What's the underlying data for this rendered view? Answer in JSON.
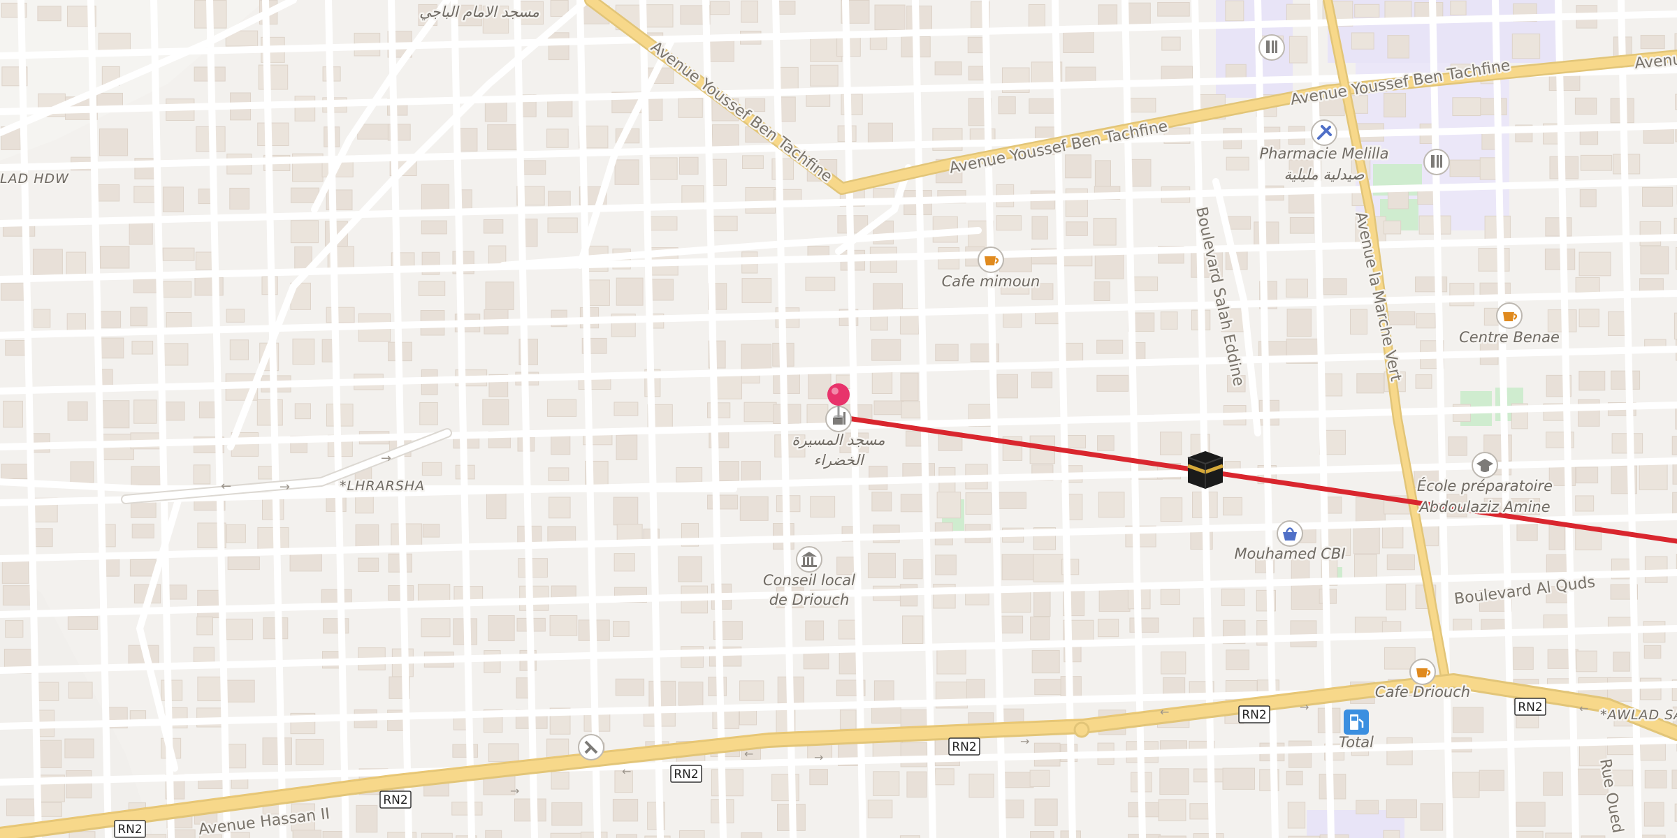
{
  "map": {
    "labels": {
      "mosque_imam_baji": "مسجد الامام الباجي",
      "avenue_youssef_1": "Avenue Youssef Ben Tachfine",
      "avenue_youssef_2": "Avenue Youssef Ben Tachfine",
      "avenue_youssef_3": "Avenue Youssef Ben Tachfine",
      "avenue_youssef_4": "Avenu",
      "lad_hdw": "LAD HDW",
      "pharmacie_fr": "Pharmacie Melilla",
      "pharmacie_ar": "صيدلية مليلية",
      "cafe_mimoun": "Cafe mimoun",
      "boulevard_salah": "Boulevard Salah Eddine",
      "avenue_marche": "Avenue la Marche Vert",
      "centre_benae": "Centre Benae",
      "lhrarsha": "*LHRARSHA",
      "mosque_massira_1": "مسجد المسيرة",
      "mosque_massira_2": "الخضراء",
      "ecole_1": "École préparatoire",
      "ecole_2": "Abdoulaziz Amine",
      "mouhamed_cbi": "Mouhamed CBI",
      "boulevard_quds": "Boulevard Al Quds",
      "conseil_1": "Conseil local",
      "conseil_2": "de Driouch",
      "cafe_driouch": "Cafe Driouch",
      "awlad": "*AWLAD SA",
      "total": "Total",
      "avenue_hassan": "Avenue Hassan II",
      "rue_oued": "Rue Oued"
    },
    "route_shields": [
      "RN2",
      "RN2",
      "RN2",
      "RN2",
      "RN2",
      "RN2"
    ],
    "colors": {
      "background": "#f3f1ee",
      "building": "#e8e0d8",
      "road_major": "#f7d88a",
      "route_line": "#d9262e",
      "marker": "#e8336b",
      "poi_icon": "#7d7b78",
      "cafe_icon": "#e08a1e",
      "shop_icon": "#4f6fc7",
      "fuel_icon": "#3b8fe0",
      "education_zone": "#e8e4f7",
      "park": "#cfeccf"
    },
    "icons": {
      "marker": "map-pin-icon",
      "kaaba": "kaaba-icon",
      "cafe": "coffee-cup-icon",
      "pharmacy": "pharmacy-icon",
      "school": "graduation-cap-icon",
      "shop": "shopping-basket-icon",
      "townhall": "government-building-icon",
      "fuel": "fuel-pump-icon",
      "education": "education-icon",
      "mosque": "mosque-icon"
    }
  }
}
